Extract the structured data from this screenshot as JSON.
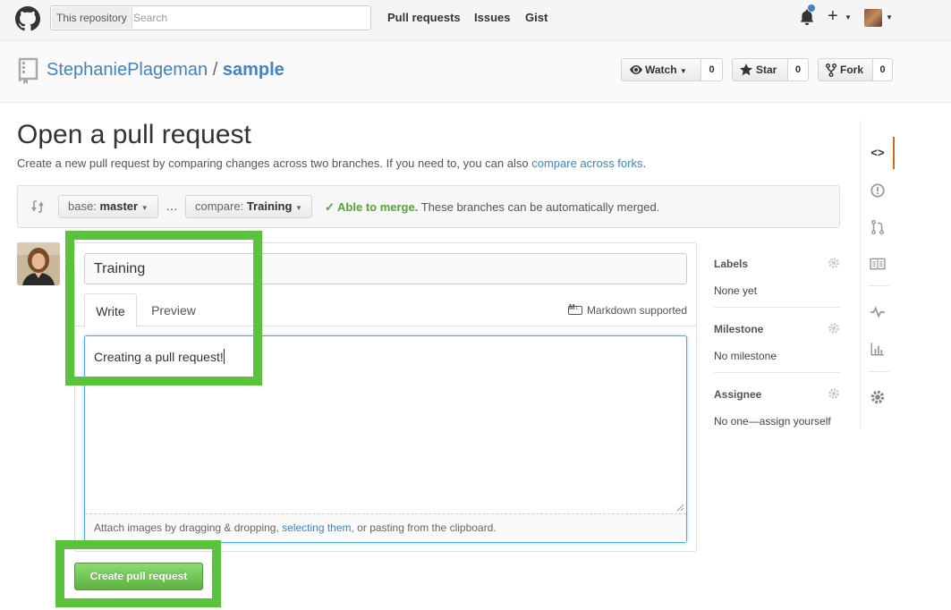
{
  "header": {
    "search_scope": "This repository",
    "search_placeholder": "Search",
    "nav": [
      "Pull requests",
      "Issues",
      "Gist"
    ],
    "icons": [
      "github-logo-icon",
      "bell-icon",
      "plus-icon",
      "avatar"
    ]
  },
  "repo": {
    "owner": "StephaniePlageman",
    "separator": "/",
    "name": "sample",
    "watch_label": "Watch",
    "watch_count": "0",
    "star_label": "Star",
    "star_count": "0",
    "fork_label": "Fork",
    "fork_count": "0"
  },
  "page": {
    "title": "Open a pull request",
    "subtitle": "Create a new pull request by comparing changes across two branches. If you need to, you can also ",
    "subtitle_link": "compare across forks",
    "subtitle_end": "."
  },
  "range": {
    "base_prefix": "base:",
    "base_branch": "master",
    "ellipsis": "…",
    "compare_prefix": "compare:",
    "compare_branch": "Training",
    "merge_status": "Able to merge.",
    "merge_text": " These branches can be automatically merged."
  },
  "form": {
    "title_value": "Training",
    "tab_write": "Write",
    "tab_preview": "Preview",
    "markdown": "Markdown supported",
    "body_text": "Creating a pull request!",
    "attach_pre": "Attach images by dragging & dropping, ",
    "attach_link": "selecting them",
    "attach_post": ", or pasting from the clipboard.",
    "submit": "Create pull request"
  },
  "sidebar": {
    "labels_title": "Labels",
    "labels_value": "None yet",
    "milestone_title": "Milestone",
    "milestone_value": "No milestone",
    "assignee_title": "Assignee",
    "assignee_value": "No one—assign yourself"
  },
  "colors": {
    "accent": "#4183c4",
    "highlight": "#5bc23d",
    "button_green": "#60b044",
    "merge_ok": "#55a532",
    "nav_active": "#d26911"
  }
}
